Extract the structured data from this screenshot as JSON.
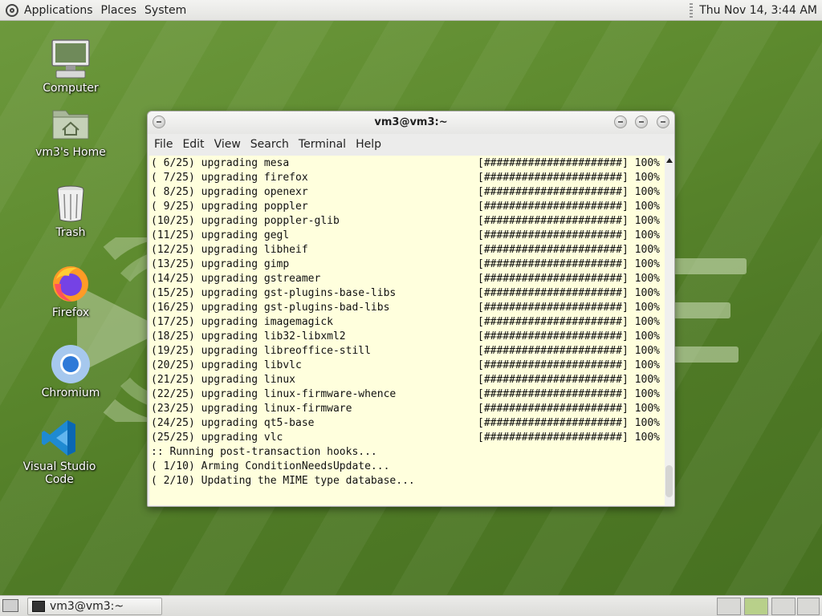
{
  "top_panel": {
    "menu": [
      "Applications",
      "Places",
      "System"
    ],
    "clock": "Thu Nov 14,  3:44 AM"
  },
  "desktop": {
    "icons": [
      {
        "label": "Computer",
        "icon": "computer-icon"
      },
      {
        "label": "vm3's Home",
        "icon": "home-folder-icon"
      },
      {
        "label": "Trash",
        "icon": "trash-icon"
      },
      {
        "label": "Firefox",
        "icon": "firefox-icon"
      },
      {
        "label": "Chromium",
        "icon": "chromium-icon"
      },
      {
        "label": "Visual Studio Code",
        "icon": "vscode-icon"
      }
    ]
  },
  "window": {
    "title": "vm3@vm3:~",
    "menu": [
      "File",
      "Edit",
      "View",
      "Search",
      "Terminal",
      "Help"
    ]
  },
  "terminal": {
    "upgrades": [
      {
        "text": "( 6/25) upgrading mesa",
        "progress": "[######################] 100%"
      },
      {
        "text": "( 7/25) upgrading firefox",
        "progress": "[######################] 100%"
      },
      {
        "text": "( 8/25) upgrading openexr",
        "progress": "[######################] 100%"
      },
      {
        "text": "( 9/25) upgrading poppler",
        "progress": "[######################] 100%"
      },
      {
        "text": "(10/25) upgrading poppler-glib",
        "progress": "[######################] 100%"
      },
      {
        "text": "(11/25) upgrading gegl",
        "progress": "[######################] 100%"
      },
      {
        "text": "(12/25) upgrading libheif",
        "progress": "[######################] 100%"
      },
      {
        "text": "(13/25) upgrading gimp",
        "progress": "[######################] 100%"
      },
      {
        "text": "(14/25) upgrading gstreamer",
        "progress": "[######################] 100%"
      },
      {
        "text": "(15/25) upgrading gst-plugins-base-libs",
        "progress": "[######################] 100%"
      },
      {
        "text": "(16/25) upgrading gst-plugins-bad-libs",
        "progress": "[######################] 100%"
      },
      {
        "text": "(17/25) upgrading imagemagick",
        "progress": "[######################] 100%"
      },
      {
        "text": "(18/25) upgrading lib32-libxml2",
        "progress": "[######################] 100%"
      },
      {
        "text": "(19/25) upgrading libreoffice-still",
        "progress": "[######################] 100%"
      },
      {
        "text": "(20/25) upgrading libvlc",
        "progress": "[######################] 100%"
      },
      {
        "text": "(21/25) upgrading linux",
        "progress": "[######################] 100%"
      },
      {
        "text": "(22/25) upgrading linux-firmware-whence",
        "progress": "[######################] 100%"
      },
      {
        "text": "(23/25) upgrading linux-firmware",
        "progress": "[######################] 100%"
      },
      {
        "text": "(24/25) upgrading qt5-base",
        "progress": "[######################] 100%"
      },
      {
        "text": "(25/25) upgrading vlc",
        "progress": "[######################] 100%"
      }
    ],
    "tail": [
      ":: Running post-transaction hooks...",
      "( 1/10) Arming ConditionNeedsUpdate...",
      "( 2/10) Updating the MIME type database..."
    ]
  },
  "taskbar": {
    "tasks": [
      {
        "label": "vm3@vm3:~"
      }
    ]
  }
}
